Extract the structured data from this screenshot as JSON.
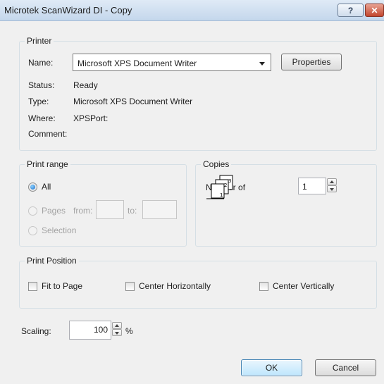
{
  "window": {
    "title": "Microtek ScanWizard DI - Copy",
    "help_label": "?",
    "close_label": "✕"
  },
  "printer": {
    "group_label": "Printer",
    "name_label": "Name:",
    "name_value": "Microsoft XPS Document Writer",
    "properties_label": "Properties",
    "status_label": "Status:",
    "status_value": "Ready",
    "type_label": "Type:",
    "type_value": "Microsoft XPS Document Writer",
    "where_label": "Where:",
    "where_value": "XPSPort:",
    "comment_label": "Comment:"
  },
  "print_range": {
    "group_label": "Print range",
    "all_label": "All",
    "pages_label": "Pages",
    "from_label": "from:",
    "to_label": "to:",
    "from_value": "",
    "to_value": "",
    "selection_label": "Selection",
    "selected": "All"
  },
  "copies": {
    "group_label": "Copies",
    "number_label": "Number of",
    "number_value": "1"
  },
  "print_position": {
    "group_label": "Print Position",
    "fit_to_page_label": "Fit to Page",
    "center_h_label": "Center Horizontally",
    "center_v_label": "Center Vertically",
    "fit_to_page_checked": false,
    "center_h_checked": false,
    "center_v_checked": false
  },
  "scaling": {
    "label": "Scaling:",
    "value": "100",
    "unit": "%"
  },
  "buttons": {
    "ok_label": "OK",
    "cancel_label": "Cancel"
  },
  "icons": {
    "help": "help-icon",
    "close": "close-icon",
    "copies": "collate-copies-icon",
    "dropdown": "chevron-down-icon"
  }
}
